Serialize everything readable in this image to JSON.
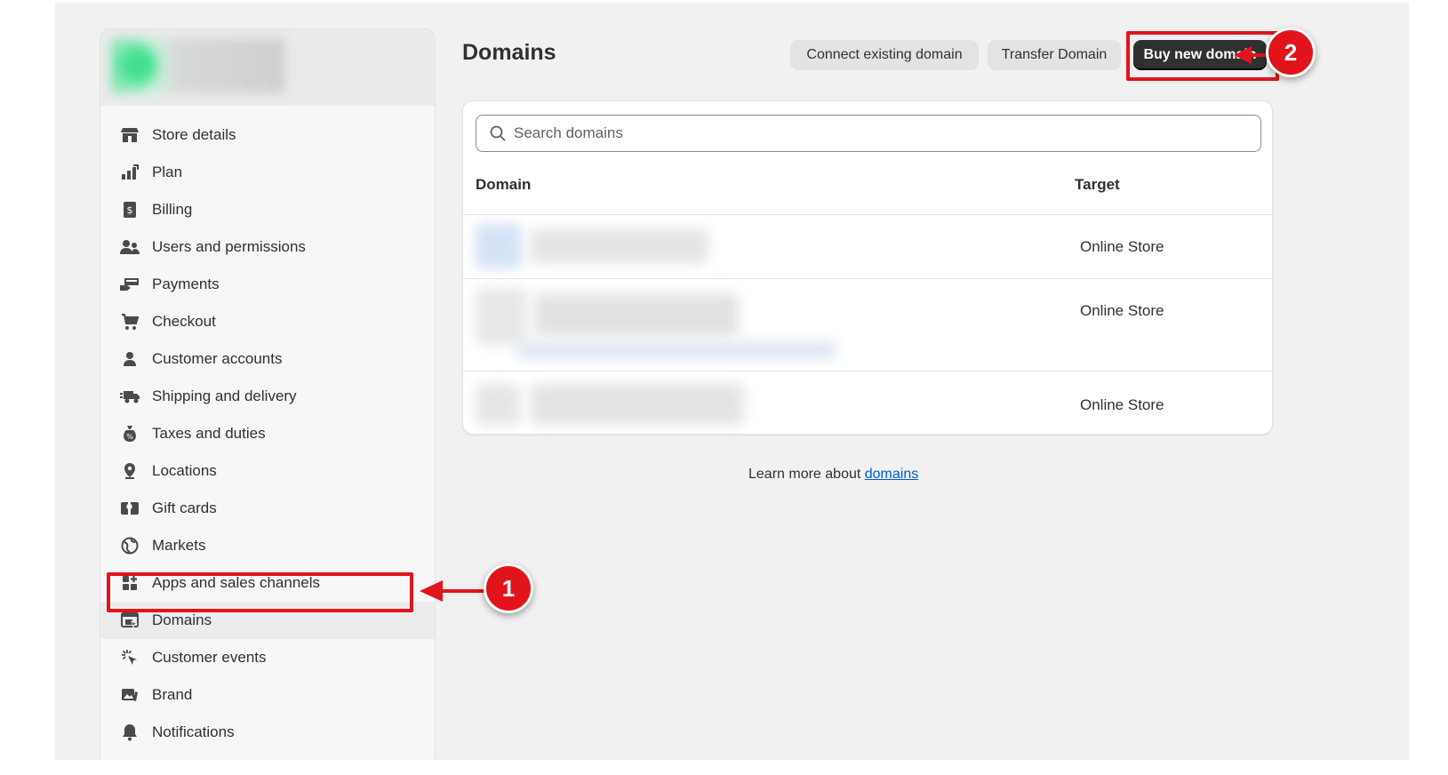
{
  "sidebar": {
    "items": [
      {
        "label": "Store details",
        "icon": "store-icon"
      },
      {
        "label": "Plan",
        "icon": "plan-chart-icon"
      },
      {
        "label": "Billing",
        "icon": "billing-receipt-icon"
      },
      {
        "label": "Users and permissions",
        "icon": "users-icon"
      },
      {
        "label": "Payments",
        "icon": "payments-hand-icon"
      },
      {
        "label": "Checkout",
        "icon": "cart-icon"
      },
      {
        "label": "Customer accounts",
        "icon": "person-icon"
      },
      {
        "label": "Shipping and delivery",
        "icon": "truck-icon"
      },
      {
        "label": "Taxes and duties",
        "icon": "tax-bag-icon"
      },
      {
        "label": "Locations",
        "icon": "location-pin-icon"
      },
      {
        "label": "Gift cards",
        "icon": "gift-card-icon"
      },
      {
        "label": "Markets",
        "icon": "globe-icon"
      },
      {
        "label": "Apps and sales channels",
        "icon": "apps-grid-icon"
      },
      {
        "label": "Domains",
        "icon": "domains-icon"
      },
      {
        "label": "Customer events",
        "icon": "cursor-click-icon"
      },
      {
        "label": "Brand",
        "icon": "brand-image-icon"
      },
      {
        "label": "Notifications",
        "icon": "bell-icon"
      }
    ],
    "active": "Domains"
  },
  "header": {
    "title": "Domains",
    "connect_label": "Connect existing domain",
    "transfer_label": "Transfer Domain",
    "buy_label": "Buy new domain"
  },
  "search": {
    "placeholder": "Search domains"
  },
  "table": {
    "col_domain": "Domain",
    "col_target": "Target",
    "rows": [
      {
        "target": "Online Store"
      },
      {
        "target": "Online Store"
      },
      {
        "target": "Online Store"
      }
    ]
  },
  "footer": {
    "text": "Learn more about ",
    "link": "domains"
  },
  "annotations": {
    "step1": "1",
    "step2": "2",
    "color": "#e1141b"
  }
}
